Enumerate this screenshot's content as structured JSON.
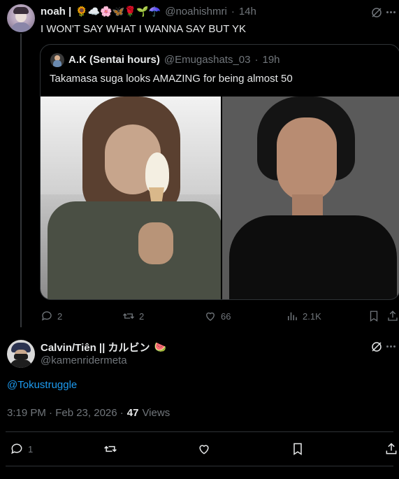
{
  "parent_tweet": {
    "author_name": "noah |",
    "emojis": "🌻☁️🌸🦋🌹🌱☂️",
    "handle": "@noahishmri",
    "time": "14h",
    "text": "I WON'T SAY WHAT I WANNA SAY BUT YK",
    "quoted": {
      "author_name": "A.K (Sentai hours)",
      "handle": "@Emugashats_03",
      "time": "19h",
      "text": "Takamasa suga looks AMAZING for being almost 50"
    },
    "actions": {
      "replies": "2",
      "reposts": "2",
      "likes": "66",
      "views": "2.1K"
    }
  },
  "main_tweet": {
    "author_name": "Calvin/Tiên || カルビン",
    "emoji": "🍉",
    "handle": "@kamenridermeta",
    "text": "@Tokustruggle",
    "timestamp": "3:19 PM · Feb 23, 2026 ·",
    "views_count": "47",
    "views_label": "Views",
    "actions": {
      "replies": "1"
    }
  },
  "colors": {
    "background": "#000000",
    "text": "#e7e9ea",
    "muted": "#71767b",
    "link": "#1d9bf0",
    "border": "#2f3336"
  }
}
